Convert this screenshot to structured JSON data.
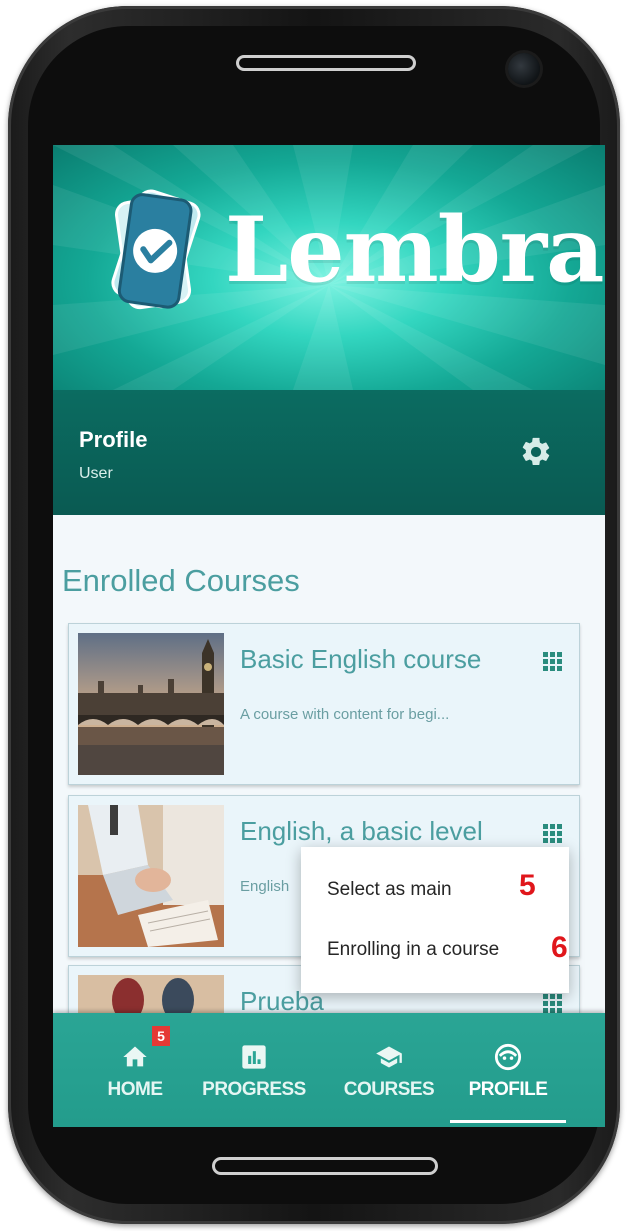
{
  "app": {
    "name": "Lembra"
  },
  "profile": {
    "title": "Profile",
    "subtitle": "User"
  },
  "enrolled": {
    "heading": "Enrolled Courses",
    "courses": [
      {
        "title": "Basic English course",
        "description": "A course with content for begi..."
      },
      {
        "title": "English, a basic level",
        "description": "English"
      },
      {
        "title": "Prueba",
        "description": ""
      }
    ]
  },
  "context_menu": {
    "items": [
      {
        "label": "Select as main",
        "step": "5"
      },
      {
        "label": "Enrolling in a course",
        "step": "6"
      }
    ]
  },
  "bottom_nav": {
    "items": [
      {
        "label": "HOME",
        "icon": "home-icon",
        "badge": "5"
      },
      {
        "label": "PROGRESS",
        "icon": "bar-chart-icon"
      },
      {
        "label": "COURSES",
        "icon": "graduation-cap-icon"
      },
      {
        "label": "PROFILE",
        "icon": "smiley-icon",
        "active": true
      }
    ]
  },
  "colors": {
    "primary": "#239c8c",
    "primary_dark": "#0a5a52",
    "heading": "#4b9ea0",
    "step_marker": "#e0161b",
    "badge": "#e53935"
  }
}
